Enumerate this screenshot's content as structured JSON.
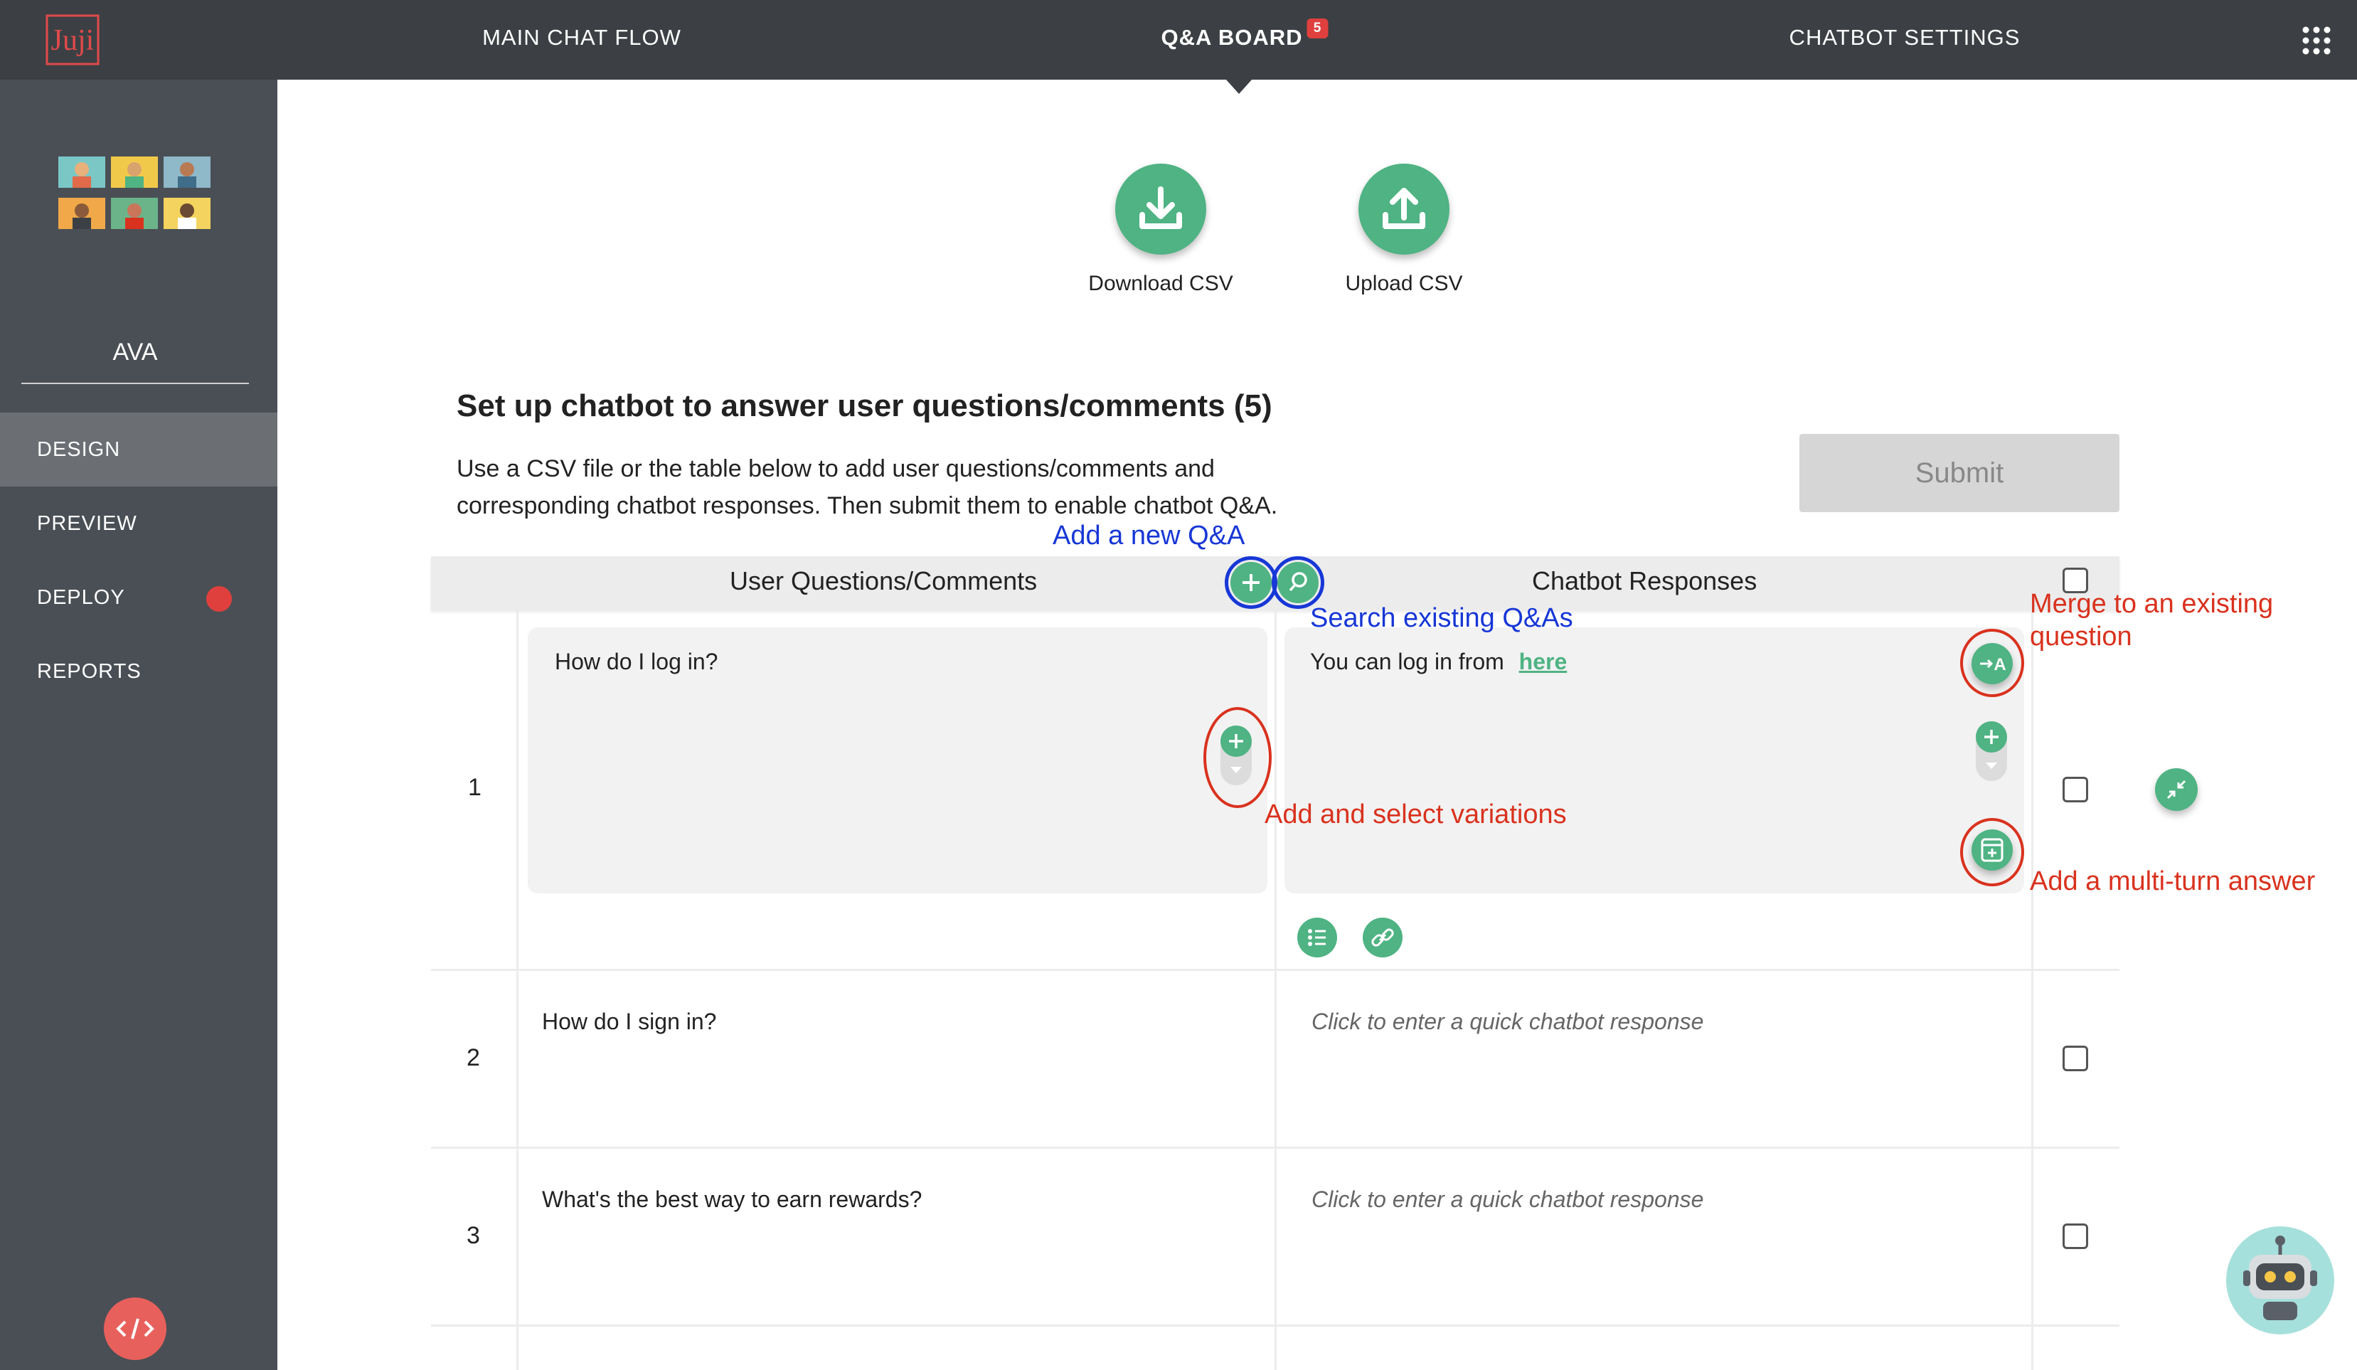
{
  "topbar": {
    "logo_text": "Juji",
    "tabs": [
      {
        "label": "MAIN CHAT FLOW"
      },
      {
        "label": "Q&A BOARD",
        "badge": "5"
      },
      {
        "label": "CHATBOT SETTINGS"
      }
    ]
  },
  "sidebar": {
    "bot_name": "AVA",
    "items": [
      {
        "label": "DESIGN"
      },
      {
        "label": "PREVIEW"
      },
      {
        "label": "DEPLOY"
      },
      {
        "label": "REPORTS"
      }
    ]
  },
  "actions": {
    "download_label": "Download CSV",
    "upload_label": "Upload CSV"
  },
  "section": {
    "title": "Set up chatbot to answer user questions/comments (5)",
    "description_line1": "Use a CSV file or the table below to add user questions/comments and",
    "description_line2": "corresponding chatbot responses. Then submit them to enable chatbot Q&A.",
    "submit_label": "Submit"
  },
  "table": {
    "col_questions": "User Questions/Comments",
    "col_responses": "Chatbot Responses",
    "rows": [
      {
        "num": "1",
        "question": "How do I log in?",
        "response_prefix": "You can log in from",
        "response_link": "here"
      },
      {
        "num": "2",
        "question": "How do I sign in?",
        "response_placeholder": "Click to enter a quick chatbot response"
      },
      {
        "num": "3",
        "question": "What's the best way to earn rewards?",
        "response_placeholder": "Click to enter a quick chatbot response"
      }
    ]
  },
  "annotations": {
    "add_new_qa": "Add a new Q&A",
    "search_existing": "Search existing Q&As",
    "merge_line1": "Merge to an existing",
    "merge_line2": "question",
    "add_variations": "Add and select variations",
    "add_multiturn": "Add a multi-turn answer"
  },
  "colors": {
    "accent_green": "#4fb383",
    "topbar_bg": "#3c4044",
    "sidebar_bg": "#4a4f55",
    "annotation_red": "#d9321e",
    "annotation_blue": "#1737d6"
  }
}
